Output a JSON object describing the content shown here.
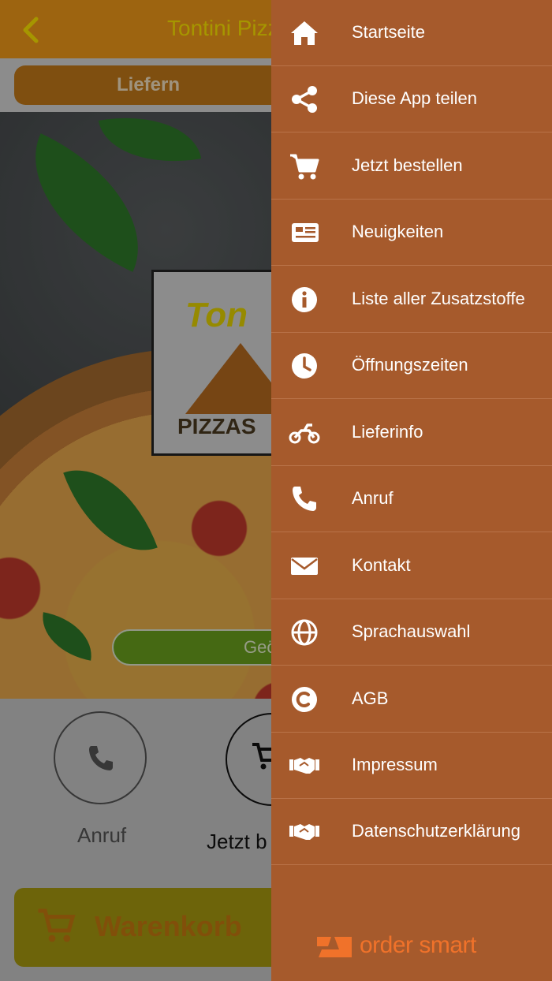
{
  "header": {
    "title": "Tontini Pizz"
  },
  "tabs": {
    "deliver_label": "Liefern"
  },
  "hero": {
    "logo_text": "Ton",
    "logo_sub": "PIZZAS",
    "open_badge": "Geö"
  },
  "actions": {
    "call_label": "Anruf",
    "order_label": "Jetzt b",
    "cart_label": "Warenkorb"
  },
  "drawer": {
    "items": [
      {
        "label": "Startseite",
        "icon": "home-icon"
      },
      {
        "label": "Diese App teilen",
        "icon": "share-icon"
      },
      {
        "label": "Jetzt bestellen",
        "icon": "cart-icon"
      },
      {
        "label": "Neuigkeiten",
        "icon": "newspaper-icon"
      },
      {
        "label": "Liste aller Zusatzstoffe",
        "icon": "info-icon"
      },
      {
        "label": "Öffnungszeiten",
        "icon": "clock-icon"
      },
      {
        "label": "Lieferinfo",
        "icon": "motorcycle-icon"
      },
      {
        "label": "Anruf",
        "icon": "phone-icon"
      },
      {
        "label": "Kontakt",
        "icon": "envelope-icon"
      },
      {
        "label": "Sprachauswahl",
        "icon": "globe-icon"
      },
      {
        "label": "AGB",
        "icon": "copyright-icon"
      },
      {
        "label": "Impressum",
        "icon": "handshake-icon"
      },
      {
        "label": "Datenschutzerklärung",
        "icon": "handshake-icon"
      }
    ],
    "brand": "order smart"
  },
  "colors": {
    "topbar": "#f29a1a",
    "title": "#ffe600",
    "drawer": "#a65a2c",
    "brand": "#f0722a"
  }
}
